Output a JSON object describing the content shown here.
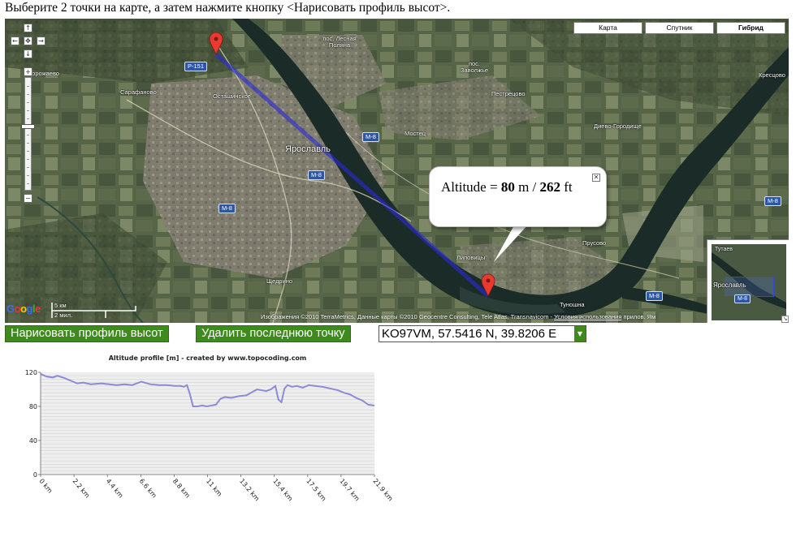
{
  "instruction": "Выберите 2 точки на карте, а затем нажмите кнопку <Нарисовать профиль высот>.",
  "map": {
    "type_buttons": [
      {
        "label": "Карта",
        "active": false
      },
      {
        "label": "Спутник",
        "active": false
      },
      {
        "label": "Гибрид",
        "active": true
      }
    ],
    "place_labels": {
      "dorozhaevo": "Дорожаево",
      "sarafanovo": "Сарафаново",
      "ostashinskoe": "Осташинское",
      "yaroslavl": "Ярославль",
      "lesnaya": "пос. Лесная Поляна",
      "zavolzhe": "пос. Заволжье",
      "pestretsovo": "Пестрецово",
      "mostets": "Мостец",
      "dievo": "Диево-Городище",
      "krestsovo": "Кресцово",
      "shedrino": "Щедрино",
      "lipovitsy": "Липовицы",
      "prusovo": "Прусово",
      "tunoshna": "Туношна"
    },
    "road_shields": {
      "r151": "Р-151",
      "m8": "М-8"
    },
    "bubble": {
      "prefix": "Altitude = ",
      "meters": "80",
      "unit_m": " m / ",
      "feet": "262",
      "unit_ft": " ft"
    },
    "overview": {
      "tutaev": "Тутаев",
      "yaroslavl": "Ярославль",
      "m8": "М-8"
    },
    "scale": {
      "km": "5 км",
      "mi": "2 мил."
    },
    "copyright_text": "Изображения ©2010 TerraMetrics, Данные карты ©2010 Geocentre Consulting, Tele Atlas, Transnavicom - ",
    "terms_link": "Условия использования",
    "copyright_tail": " прилов. Ям"
  },
  "buttons": {
    "draw": "Нарисовать профиль высот",
    "delete": "Удалить последнюю точку"
  },
  "location_select": {
    "value": "KO97VM, 57.5416 N, 39.8206 E"
  },
  "chart_data": {
    "type": "area",
    "title": "Altitude profile [m] - created by www.topocoding.com",
    "xlabel": "",
    "ylabel": "",
    "x_tick_labels": [
      "0 km",
      "2.2 km",
      "4.4 km",
      "6.6 km",
      "8.8 km",
      "11 km",
      "13.2 km",
      "15.4 km",
      "17.5 km",
      "19.7 km",
      "21.9 km"
    ],
    "y_tick_labels": [
      "0",
      "40",
      "80",
      "120"
    ],
    "xlim": [
      0,
      21.9
    ],
    "ylim": [
      0,
      120
    ],
    "grid": true,
    "colors": {
      "line": "#8b8bd6",
      "fill": "#eeeeee"
    },
    "x": [
      0,
      0.4,
      0.8,
      1.1,
      1.6,
      2.0,
      2.4,
      2.8,
      3.3,
      4.0,
      4.5,
      5.0,
      5.5,
      6.0,
      6.6,
      7.2,
      7.8,
      8.3,
      8.8,
      9.2,
      9.4,
      9.6,
      9.8,
      10.0,
      10.3,
      10.6,
      10.9,
      11.2,
      11.5,
      11.8,
      12.1,
      12.5,
      13.0,
      13.5,
      13.9,
      14.2,
      14.5,
      14.8,
      15.1,
      15.4,
      15.6,
      15.8,
      16.0,
      16.2,
      16.5,
      16.8,
      17.2,
      17.6,
      18.0,
      18.5,
      19.0,
      19.5,
      19.9,
      20.3,
      20.7,
      21.1,
      21.5,
      21.9
    ],
    "y": [
      118,
      115,
      114,
      116,
      113,
      110,
      107,
      108,
      106,
      107,
      106,
      105,
      106,
      105,
      109,
      106,
      105,
      105,
      104,
      104,
      103,
      105,
      94,
      80,
      80,
      81,
      80,
      81,
      82,
      89,
      91,
      90,
      92,
      93,
      97,
      100,
      99,
      98,
      100,
      104,
      88,
      85,
      101,
      105,
      103,
      104,
      102,
      105,
      104,
      103,
      101,
      99,
      96,
      94,
      90,
      87,
      82,
      81
    ]
  }
}
